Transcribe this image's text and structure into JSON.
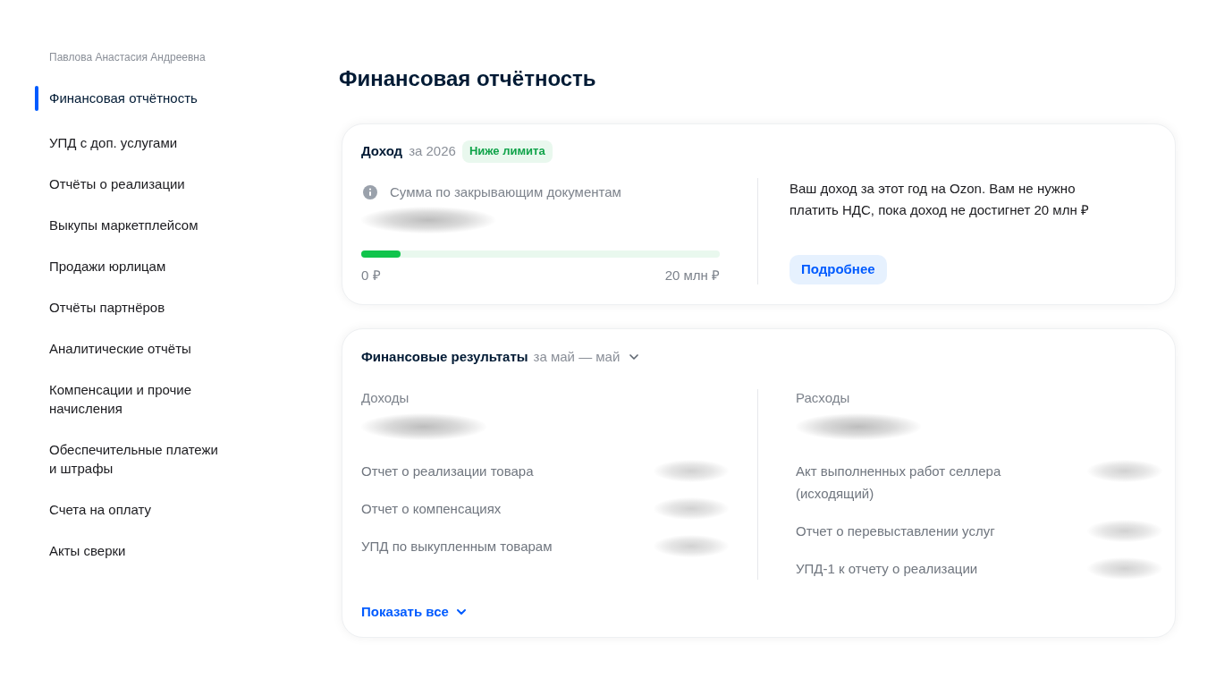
{
  "sidebar": {
    "user_name": "Павлова Анастасия Андреевна",
    "items": [
      {
        "label": "Финансовая отчётность",
        "selected": true
      },
      {
        "label": "УПД с доп. услугами",
        "selected": false
      },
      {
        "label": "Отчёты о реализации",
        "selected": false
      },
      {
        "label": "Выкупы маркетплейсом",
        "selected": false
      },
      {
        "label": "Продажи юрлицам",
        "selected": false
      },
      {
        "label": "Отчёты партнёров",
        "selected": false
      },
      {
        "label": "Аналитические отчёты",
        "selected": false
      },
      {
        "label": "Компенсации и прочие начисления",
        "selected": false
      },
      {
        "label": "Обеспечительные платежи и штрафы",
        "selected": false
      },
      {
        "label": "Счета на оплату",
        "selected": false
      },
      {
        "label": "Акты сверки",
        "selected": false
      }
    ]
  },
  "page_title": "Финансовая отчётность",
  "income_card": {
    "title": "Доход",
    "period": "за 2026",
    "badge": "Ниже лимита",
    "sum_label": "Сумма по закрывающим документам",
    "progress": {
      "level": 0.11,
      "min_label": "0 ₽",
      "max_label": "20 млн ₽"
    },
    "description": "Ваш доход за этот год на Ozon. Вам не нужно платить НДС, пока доход не достигнет 20 млн ₽",
    "button": "Подробнее"
  },
  "results_card": {
    "title": "Финансовые результаты",
    "period": "за май — май",
    "columns": [
      {
        "heading": "Доходы",
        "rows": [
          "Отчет о реализации товара",
          "Отчет о компенсациях",
          "УПД по выкупленным товарам"
        ]
      },
      {
        "heading": "Расходы",
        "rows": [
          "Акт выполненных работ селлера (исходящий)",
          "Отчет о перевыставлении услуг",
          "УПД-1 к отчету о реализации"
        ]
      }
    ],
    "show_all": "Показать все"
  }
}
